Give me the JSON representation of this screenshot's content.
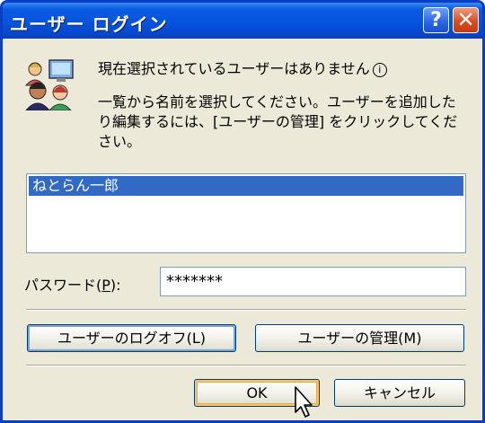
{
  "window": {
    "title": "ユーザー ログイン",
    "help_label": "?",
    "close_label": "✕"
  },
  "message": {
    "heading": "現在選択されているユーザーはありません",
    "body": "一覧から名前を選択してください。ユーザーを追加したり編集するには、[ユーザーの管理] をクリックしてください。"
  },
  "user_list": {
    "items": [
      {
        "label": "ねとらん一郎",
        "selected": true
      }
    ]
  },
  "password": {
    "label_before": "パスワード(",
    "label_key": "P",
    "label_after": "):",
    "value": "*******"
  },
  "buttons": {
    "logoff": "ユーザーのログオフ(L)",
    "manage": "ユーザーの管理(M)",
    "ok": "OK",
    "cancel": "キャンセル"
  },
  "icons": {
    "info": "i",
    "users": "users-icon",
    "cursor": "mouse-cursor-icon"
  },
  "colors": {
    "titlebar": "#0654df",
    "selection": "#316ac5",
    "dialog_bg": "#ece9d8"
  }
}
